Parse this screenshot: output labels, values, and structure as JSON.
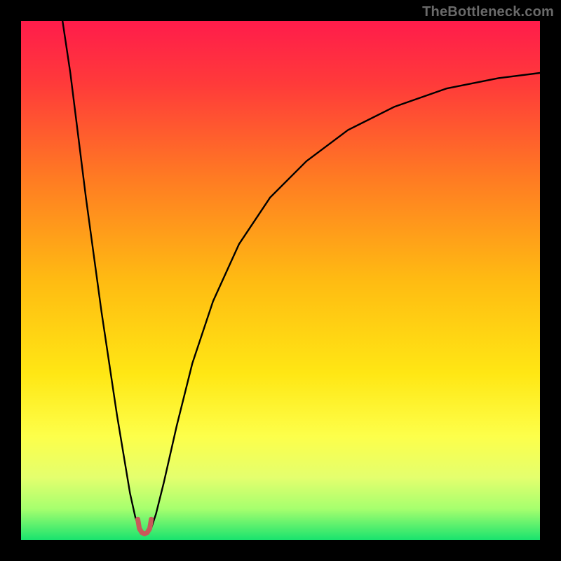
{
  "watermark": "TheBottleneck.com",
  "chart_data": {
    "type": "line",
    "title": "",
    "xlabel": "",
    "ylabel": "",
    "xlim": [
      0,
      100
    ],
    "ylim": [
      0,
      100
    ],
    "gradient_stops": [
      {
        "offset": 0.0,
        "color": "#ff1c4b"
      },
      {
        "offset": 0.12,
        "color": "#ff3a3a"
      },
      {
        "offset": 0.3,
        "color": "#ff7a23"
      },
      {
        "offset": 0.5,
        "color": "#ffbb12"
      },
      {
        "offset": 0.68,
        "color": "#ffe714"
      },
      {
        "offset": 0.8,
        "color": "#fdff4a"
      },
      {
        "offset": 0.88,
        "color": "#e4ff6e"
      },
      {
        "offset": 0.94,
        "color": "#a6ff6e"
      },
      {
        "offset": 1.0,
        "color": "#19e36e"
      }
    ],
    "series": [
      {
        "name": "curve",
        "points": [
          {
            "x": 8.0,
            "y": 100.0
          },
          {
            "x": 9.5,
            "y": 90.0
          },
          {
            "x": 11.0,
            "y": 78.0
          },
          {
            "x": 12.5,
            "y": 66.0
          },
          {
            "x": 14.0,
            "y": 55.0
          },
          {
            "x": 15.5,
            "y": 44.0
          },
          {
            "x": 17.0,
            "y": 34.0
          },
          {
            "x": 18.5,
            "y": 24.0
          },
          {
            "x": 20.0,
            "y": 15.0
          },
          {
            "x": 21.0,
            "y": 9.0
          },
          {
            "x": 22.0,
            "y": 4.5
          },
          {
            "x": 22.8,
            "y": 2.0
          },
          {
            "x": 23.5,
            "y": 1.2
          },
          {
            "x": 24.2,
            "y": 1.2
          },
          {
            "x": 25.0,
            "y": 2.0
          },
          {
            "x": 26.0,
            "y": 5.0
          },
          {
            "x": 27.5,
            "y": 11.0
          },
          {
            "x": 30.0,
            "y": 22.0
          },
          {
            "x": 33.0,
            "y": 34.0
          },
          {
            "x": 37.0,
            "y": 46.0
          },
          {
            "x": 42.0,
            "y": 57.0
          },
          {
            "x": 48.0,
            "y": 66.0
          },
          {
            "x": 55.0,
            "y": 73.0
          },
          {
            "x": 63.0,
            "y": 79.0
          },
          {
            "x": 72.0,
            "y": 83.5
          },
          {
            "x": 82.0,
            "y": 87.0
          },
          {
            "x": 92.0,
            "y": 89.0
          },
          {
            "x": 100.0,
            "y": 90.0
          }
        ]
      },
      {
        "name": "marker",
        "color": "#c85a5a",
        "stroke_width": 7,
        "points": [
          {
            "x": 22.5,
            "y": 4.0
          },
          {
            "x": 22.8,
            "y": 2.2
          },
          {
            "x": 23.3,
            "y": 1.4
          },
          {
            "x": 23.8,
            "y": 1.2
          },
          {
            "x": 24.3,
            "y": 1.4
          },
          {
            "x": 24.8,
            "y": 2.2
          },
          {
            "x": 25.1,
            "y": 4.0
          }
        ]
      }
    ]
  }
}
